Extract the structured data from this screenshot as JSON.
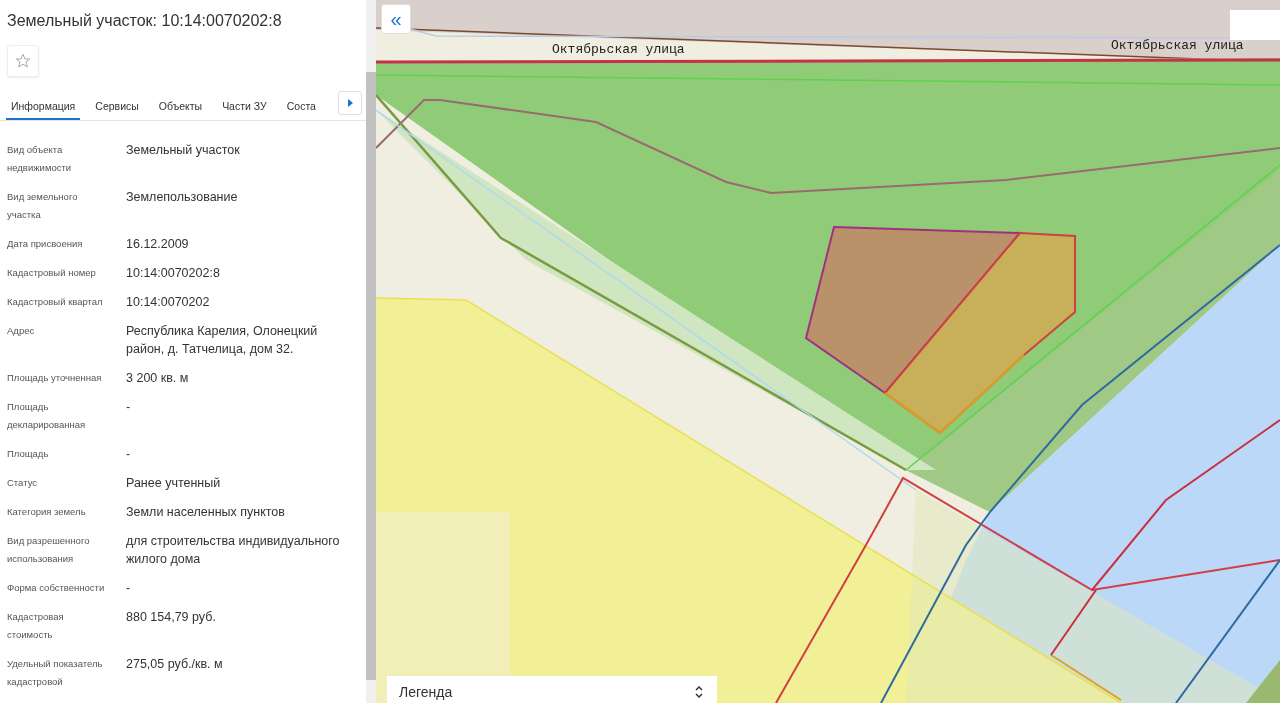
{
  "panel": {
    "title": "Земельный участок: 10:14:0070202:8",
    "favorite": false,
    "tabs": [
      {
        "label": "Информация",
        "selected": true
      },
      {
        "label": "Сервисы",
        "selected": false
      },
      {
        "label": "Объекты",
        "selected": false
      },
      {
        "label": "Части ЗУ",
        "selected": false
      },
      {
        "label": "Соста",
        "selected": false
      }
    ],
    "rows": [
      {
        "label": "Вид объекта недвижимости",
        "value": "Земельный участок"
      },
      {
        "label": "Вид земельного участка",
        "value": "Землепользование"
      },
      {
        "label": "Дата присвоения",
        "value": "16.12.2009"
      },
      {
        "label": "Кадастровый номер",
        "value": "10:14:0070202:8"
      },
      {
        "label": "Кадастровый квартал",
        "value": "10:14:0070202"
      },
      {
        "label": "Адрес",
        "value": "Республика Карелия, Олонецкий район, д. Татчелица, дом 32."
      },
      {
        "label": "Площадь уточненная",
        "value": "3 200 кв. м"
      },
      {
        "label": "Площадь декларированная",
        "value": "-"
      },
      {
        "label": "Площадь",
        "value": "-"
      },
      {
        "label": "Статус",
        "value": "Ранее учтенный"
      },
      {
        "label": "Категория земель",
        "value": "Земли населенных пунктов"
      },
      {
        "label": "Вид разрешенного использования",
        "value": "для строительства индивидуального жилого дома"
      },
      {
        "label": "Форма собственности",
        "value": "-"
      },
      {
        "label": "Кадастровая стоимость",
        "value": "880 154,79 руб."
      },
      {
        "label": "Удельный показатель кадастровой",
        "value": "275,05 руб./кв. м"
      }
    ]
  },
  "map": {
    "collapse_button": "«",
    "street_labels": [
      "Октябрьская улица",
      "Октябрьская улица"
    ],
    "legend": {
      "title": "Легенда"
    }
  }
}
